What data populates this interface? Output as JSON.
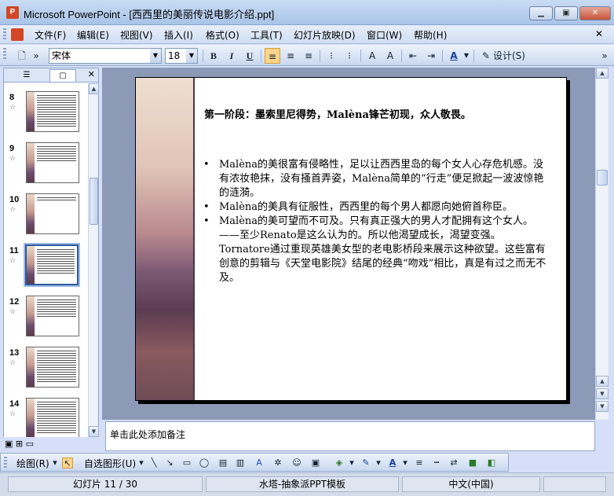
{
  "window": {
    "title": "Microsoft PowerPoint - [西西里的美丽传说电影介绍.ppt]",
    "app_icon": "P",
    "minimize": "▁",
    "maximize": "▣",
    "close": "✕"
  },
  "menu": {
    "items": [
      "文件(F)",
      "编辑(E)",
      "视图(V)",
      "插入(I)",
      "格式(O)",
      "工具(T)",
      "幻灯片放映(D)",
      "窗口(W)",
      "帮助(H)"
    ],
    "close_doc": "✕"
  },
  "toolbar": {
    "font_name": "宋体",
    "font_size": "18",
    "bold": "B",
    "italic": "I",
    "underline": "U",
    "design_label": "设计(S)"
  },
  "left_panel": {
    "tab_outline": "☰",
    "tab_slides": "▢",
    "close": "✕",
    "slides": [
      {
        "num": "8",
        "selected": false
      },
      {
        "num": "9",
        "selected": false
      },
      {
        "num": "10",
        "selected": false
      },
      {
        "num": "11",
        "selected": true
      },
      {
        "num": "12",
        "selected": false
      },
      {
        "num": "13",
        "selected": false
      },
      {
        "num": "14",
        "selected": false
      }
    ],
    "star": "☆"
  },
  "slide": {
    "title": "第一阶段：墨索里尼得势，Malèna锋芒初现，众人敬畏。",
    "bullet_char": "•",
    "bullets": [
      "Malèna的美很富有侵略性，足以让西西里岛的每个女人心存危机感。没有浓妆艳抹，没有搔首弄姿，Malèna简单的“行走”便足掀起一波波惊艳的涟漪。",
      "Malèna的美具有征服性，西西里的每个男人都愿向她俯首称臣。",
      "Malèna的美可望而不可及。只有真正强大的男人才配拥有这个女人。——至少Renato是这么认为的。所以他渴望成长，渴望变强。Tornatore通过重现英雄美女型的老电影桥段来展示这种欲望。这些富有创意的剪辑与《天堂电影院》结尾的经典“吻戏”相比，真是有过之而无不及。"
    ]
  },
  "notes": {
    "placeholder": "单击此处添加备注"
  },
  "drawing_toolbar": {
    "draw_label": "绘图(R)",
    "autoshapes_label": "自选图形(U)"
  },
  "status": {
    "slide_info": "幻灯片 11 / 30",
    "template": "水塔-抽象派PPT模板",
    "language": "中文(中国)"
  }
}
